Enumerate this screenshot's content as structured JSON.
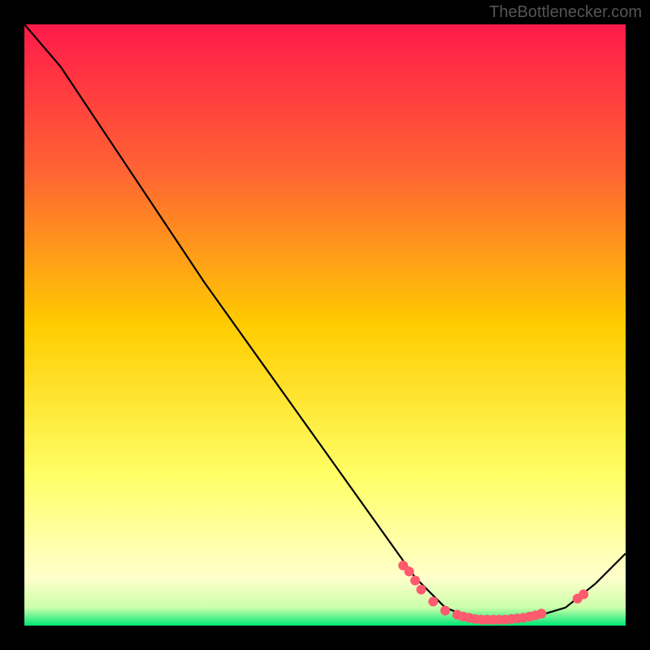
{
  "watermark": "TheBottlenecker.com",
  "chart_data": {
    "type": "line",
    "title": "",
    "xlabel": "",
    "ylabel": "",
    "xlim": [
      0,
      100
    ],
    "ylim": [
      0,
      100
    ],
    "background_gradient": {
      "stops": [
        {
          "offset": 0,
          "color": "#ff1a4a"
        },
        {
          "offset": 0.25,
          "color": "#ff6633"
        },
        {
          "offset": 0.5,
          "color": "#ffcc00"
        },
        {
          "offset": 0.75,
          "color": "#ffff66"
        },
        {
          "offset": 0.92,
          "color": "#ffffcc"
        },
        {
          "offset": 0.97,
          "color": "#ccffaa"
        },
        {
          "offset": 1.0,
          "color": "#00e676"
        }
      ]
    },
    "curve": {
      "points": [
        {
          "x": 0,
          "y": 100
        },
        {
          "x": 6,
          "y": 93
        },
        {
          "x": 10,
          "y": 87
        },
        {
          "x": 20,
          "y": 72
        },
        {
          "x": 30,
          "y": 57
        },
        {
          "x": 40,
          "y": 43
        },
        {
          "x": 50,
          "y": 29
        },
        {
          "x": 60,
          "y": 15
        },
        {
          "x": 65,
          "y": 8
        },
        {
          "x": 70,
          "y": 3
        },
        {
          "x": 75,
          "y": 1
        },
        {
          "x": 80,
          "y": 1
        },
        {
          "x": 85,
          "y": 1.5
        },
        {
          "x": 90,
          "y": 3
        },
        {
          "x": 95,
          "y": 7
        },
        {
          "x": 100,
          "y": 12
        }
      ]
    },
    "markers": [
      {
        "x": 63,
        "y": 10
      },
      {
        "x": 64,
        "y": 9
      },
      {
        "x": 65,
        "y": 7.5
      },
      {
        "x": 66,
        "y": 6
      },
      {
        "x": 68,
        "y": 4
      },
      {
        "x": 70,
        "y": 2.5
      },
      {
        "x": 72,
        "y": 1.8
      },
      {
        "x": 73,
        "y": 1.5
      },
      {
        "x": 74,
        "y": 1.3
      },
      {
        "x": 75,
        "y": 1.1
      },
      {
        "x": 76,
        "y": 1.0
      },
      {
        "x": 77,
        "y": 1.0
      },
      {
        "x": 78,
        "y": 1.0
      },
      {
        "x": 79,
        "y": 1.0
      },
      {
        "x": 80,
        "y": 1.0
      },
      {
        "x": 81,
        "y": 1.1
      },
      {
        "x": 82,
        "y": 1.2
      },
      {
        "x": 83,
        "y": 1.3
      },
      {
        "x": 84,
        "y": 1.5
      },
      {
        "x": 85,
        "y": 1.7
      },
      {
        "x": 86,
        "y": 2.0
      },
      {
        "x": 92,
        "y": 4.5
      },
      {
        "x": 93,
        "y": 5.2
      }
    ],
    "marker_color": "#ff5a6e"
  }
}
